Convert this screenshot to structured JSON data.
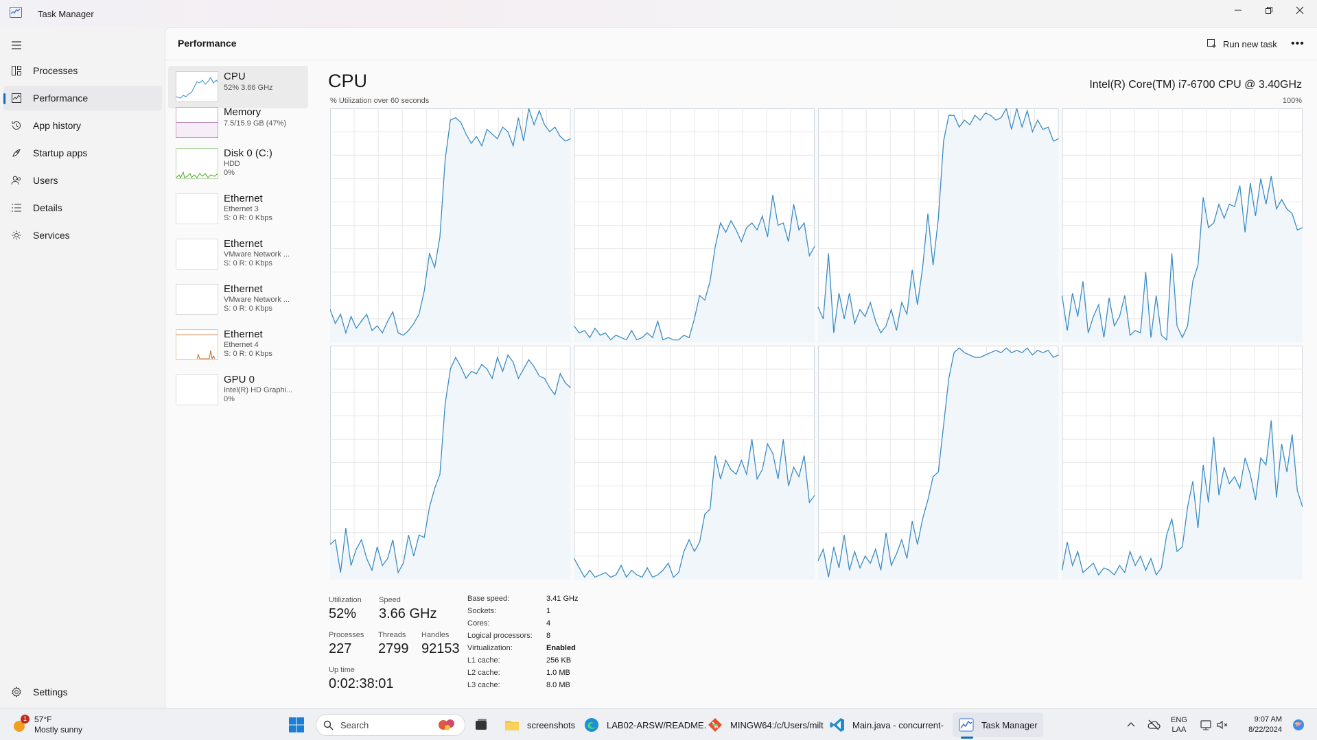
{
  "window": {
    "title": "Task Manager"
  },
  "sidebar": {
    "items": [
      {
        "label": "Processes",
        "icon": "processes-icon"
      },
      {
        "label": "Performance",
        "icon": "performance-icon",
        "active": true
      },
      {
        "label": "App history",
        "icon": "history-icon"
      },
      {
        "label": "Startup apps",
        "icon": "startup-icon"
      },
      {
        "label": "Users",
        "icon": "users-icon"
      },
      {
        "label": "Details",
        "icon": "details-icon"
      },
      {
        "label": "Services",
        "icon": "services-icon"
      }
    ],
    "settings": "Settings"
  },
  "header": {
    "title": "Performance",
    "run_new_task": "Run new task"
  },
  "resources": [
    {
      "name": "CPU",
      "sub1": "52% 3.66 GHz",
      "sub2": ""
    },
    {
      "name": "Memory",
      "sub1": "7.5/15.9 GB (47%)",
      "sub2": ""
    },
    {
      "name": "Disk 0 (C:)",
      "sub1": "HDD",
      "sub2": "0%"
    },
    {
      "name": "Ethernet",
      "sub1": "Ethernet 3",
      "sub2": "S: 0 R: 0 Kbps"
    },
    {
      "name": "Ethernet",
      "sub1": "VMware Network ...",
      "sub2": "S: 0 R: 0 Kbps"
    },
    {
      "name": "Ethernet",
      "sub1": "VMware Network ...",
      "sub2": "S: 0 R: 0 Kbps"
    },
    {
      "name": "Ethernet",
      "sub1": "Ethernet 4",
      "sub2": "S: 0 R: 0 Kbps"
    },
    {
      "name": "GPU 0",
      "sub1": "Intel(R) HD Graphi...",
      "sub2": "0%"
    }
  ],
  "cpu": {
    "title": "CPU",
    "model": "Intel(R) Core(TM) i7-6700 CPU @ 3.40GHz",
    "util_label": "% Utilization over 60 seconds",
    "max_label": "100%",
    "stats": {
      "utilization_label": "Utilization",
      "utilization": "52%",
      "speed_label": "Speed",
      "speed": "3.66 GHz",
      "processes_label": "Processes",
      "processes": "227",
      "threads_label": "Threads",
      "threads": "2799",
      "handles_label": "Handles",
      "handles": "92153",
      "uptime_label": "Up time",
      "uptime": "0:02:38:01"
    },
    "specs": [
      {
        "k": "Base speed:",
        "v": "3.41 GHz"
      },
      {
        "k": "Sockets:",
        "v": "1"
      },
      {
        "k": "Cores:",
        "v": "4"
      },
      {
        "k": "Logical processors:",
        "v": "8"
      },
      {
        "k": "Virtualization:",
        "v": "Enabled"
      },
      {
        "k": "L1 cache:",
        "v": "256 KB"
      },
      {
        "k": "L2 cache:",
        "v": "1.0 MB"
      },
      {
        "k": "L3 cache:",
        "v": "8.0 MB"
      }
    ]
  },
  "chart_data": {
    "type": "line",
    "ylim": [
      0,
      100
    ],
    "x_window_seconds": 60,
    "series": [
      {
        "values": [
          14,
          8,
          12,
          4,
          11,
          6,
          9,
          12,
          5,
          7,
          4,
          9,
          13,
          4,
          3,
          5,
          8,
          12,
          22,
          38,
          32,
          45,
          78,
          95,
          96,
          94,
          89,
          85,
          88,
          84,
          91,
          89,
          87,
          92,
          90,
          84,
          96,
          86,
          101,
          93,
          99,
          93,
          90,
          92,
          88,
          86,
          87
        ]
      },
      {
        "values": [
          7,
          4,
          5,
          2,
          6,
          3,
          4,
          1,
          3,
          2,
          1,
          5,
          1,
          2,
          4,
          2,
          9,
          1,
          2,
          1,
          1,
          3,
          2,
          10,
          20,
          18,
          26,
          41,
          51,
          47,
          52,
          48,
          43,
          49,
          51,
          48,
          54,
          45,
          63,
          50,
          51,
          43,
          59,
          48,
          51,
          37,
          41
        ]
      },
      {
        "values": [
          15,
          10,
          38,
          4,
          21,
          10,
          21,
          8,
          14,
          11,
          17,
          9,
          4,
          7,
          14,
          5,
          17,
          12,
          31,
          16,
          32,
          55,
          33,
          53,
          86,
          97,
          97,
          92,
          95,
          93,
          97,
          95,
          98,
          97,
          95,
          96,
          102,
          91,
          101,
          92,
          99,
          90,
          95,
          91,
          92,
          86,
          87
        ]
      },
      {
        "values": [
          20,
          5,
          21,
          11,
          26,
          4,
          11,
          16,
          2,
          19,
          7,
          11,
          20,
          3,
          5,
          4,
          30,
          2,
          20,
          3,
          1,
          38,
          7,
          2,
          7,
          26,
          33,
          62,
          49,
          51,
          59,
          53,
          59,
          58,
          67,
          47,
          68,
          54,
          70,
          59,
          71,
          57,
          61,
          57,
          55,
          48,
          49
        ]
      },
      {
        "values": [
          15,
          17,
          3,
          22,
          6,
          13,
          17,
          9,
          4,
          14,
          6,
          9,
          17,
          3,
          7,
          19,
          10,
          19,
          18,
          31,
          39,
          45,
          75,
          90,
          95,
          91,
          86,
          89,
          88,
          92,
          90,
          86,
          95,
          89,
          96,
          93,
          86,
          90,
          94,
          91,
          87,
          86,
          82,
          79,
          88,
          84,
          82
        ]
      },
      {
        "values": [
          9,
          5,
          1,
          4,
          1,
          2,
          3,
          1,
          2,
          6,
          1,
          4,
          2,
          1,
          5,
          1,
          2,
          4,
          7,
          1,
          3,
          12,
          17,
          12,
          16,
          28,
          30,
          53,
          43,
          51,
          47,
          45,
          51,
          45,
          60,
          43,
          47,
          58,
          54,
          43,
          60,
          40,
          48,
          44,
          53,
          33,
          36
        ]
      },
      {
        "values": [
          8,
          13,
          1,
          14,
          5,
          19,
          4,
          12,
          5,
          10,
          7,
          13,
          4,
          20,
          6,
          11,
          17,
          9,
          25,
          15,
          26,
          34,
          44,
          46,
          66,
          86,
          97,
          99,
          97,
          96,
          95,
          95,
          96,
          97,
          98,
          97,
          99,
          97,
          98,
          97,
          99,
          96,
          98,
          97,
          98,
          95,
          96
        ]
      },
      {
        "values": [
          4,
          16,
          6,
          12,
          3,
          5,
          7,
          2,
          5,
          4,
          2,
          6,
          3,
          12,
          6,
          10,
          4,
          9,
          2,
          5,
          19,
          26,
          12,
          14,
          31,
          42,
          22,
          49,
          33,
          61,
          36,
          48,
          41,
          44,
          39,
          52,
          45,
          34,
          52,
          49,
          68,
          35,
          58,
          46,
          62,
          38,
          31
        ]
      }
    ]
  },
  "taskbar": {
    "weather_temp": "57°F",
    "weather_desc": "Mostly sunny",
    "weather_badge": "1",
    "search_placeholder": "Search",
    "apps": [
      {
        "label": "screenshots",
        "icon": "folder-icon"
      },
      {
        "label": "LAB02-ARSW/README.",
        "icon": "edge-icon"
      },
      {
        "label": "MINGW64:/c/Users/milt",
        "icon": "git-bash-icon"
      },
      {
        "label": "Main.java - concurrent-",
        "icon": "vscode-icon"
      },
      {
        "label": "Task Manager",
        "icon": "task-manager-icon"
      }
    ],
    "lang1": "ENG",
    "lang2": "LAA",
    "time": "9:07 AM",
    "date": "8/22/2024"
  },
  "colors": {
    "cpu_line": "#3b8cc4",
    "cpu_fill": "#f1f6fa",
    "grid": "#e6e6e6",
    "memory": "#8b3a8b",
    "disk": "#4ca826",
    "ethernet": "#c8661e",
    "accent": "#0f6cbd"
  }
}
